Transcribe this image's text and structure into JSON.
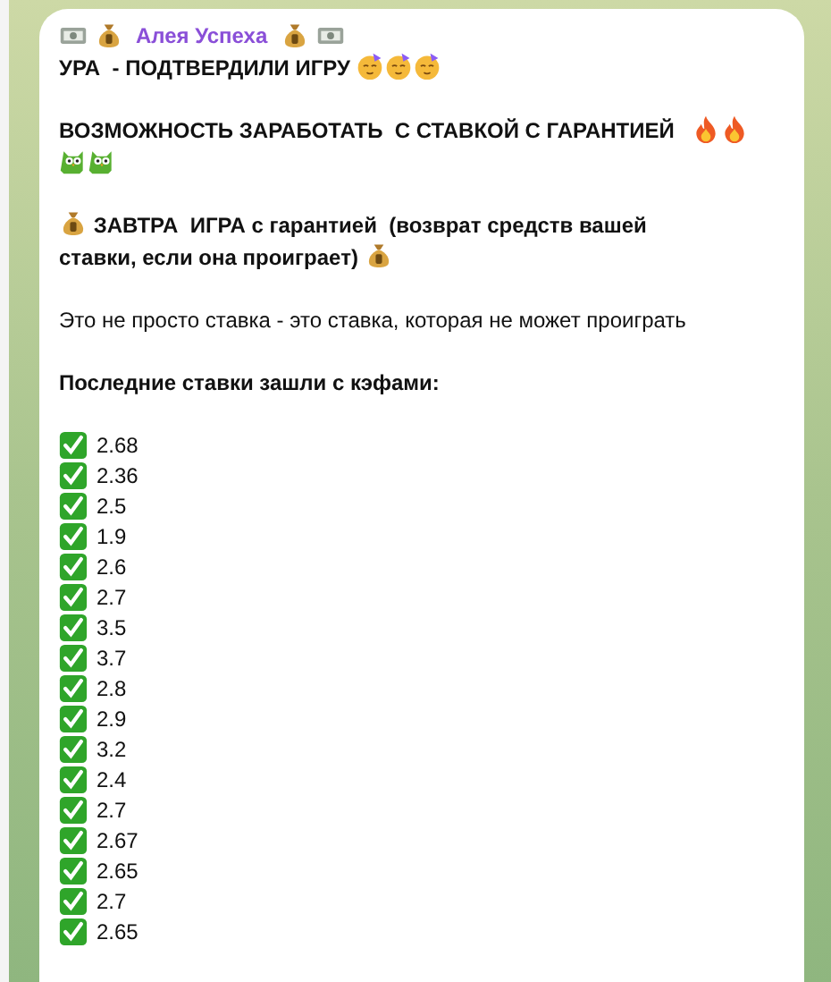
{
  "message": {
    "sender": [
      {
        "kind": "cash"
      },
      {
        "kind": "bag"
      },
      {
        "kind": "text",
        "text": "Алея Успеха"
      },
      {
        "kind": "bag"
      },
      {
        "kind": "cash"
      }
    ],
    "paragraphs": [
      {
        "bold": true,
        "parts": [
          {
            "kind": "text",
            "text": "УРА  - ПОДТВЕРДИЛИ ИГРУ "
          },
          {
            "kind": "party"
          },
          {
            "kind": "party"
          },
          {
            "kind": "party"
          }
        ]
      },
      {
        "bold": true,
        "parts": [
          {
            "kind": "text",
            "text": "ВОЗМОЖНОСТЬ ЗАРАБОТАТЬ  С СТАВКОЙ С ГАРАНТИЕЙ   "
          },
          {
            "kind": "fire"
          },
          {
            "kind": "fire"
          },
          {
            "kind": "break"
          },
          {
            "kind": "owl"
          },
          {
            "kind": "owl"
          }
        ]
      },
      {
        "bold": true,
        "parts": [
          {
            "kind": "bag"
          },
          {
            "kind": "text",
            "text": " ЗАВТРА  ИГРА с гарантией  (возврат средств вашей"
          },
          {
            "kind": "break"
          },
          {
            "kind": "text",
            "text": "ставки, если она проиграет) "
          },
          {
            "kind": "bag"
          }
        ]
      },
      {
        "bold": false,
        "parts": [
          {
            "kind": "text",
            "text": "Это не просто ставка - это ставка, которая не может проиграть"
          }
        ]
      },
      {
        "bold": true,
        "parts": [
          {
            "kind": "text",
            "text": "Последние ставки зашли с кэфами:"
          }
        ]
      }
    ],
    "odds": [
      "2.68",
      "2.36",
      "2.5",
      "1.9",
      "2.6",
      "2.7",
      "3.5",
      "3.7",
      "2.8",
      "2.9",
      "3.2",
      "2.4",
      "2.7",
      "2.67",
      "2.65",
      "2.7",
      "2.65"
    ]
  }
}
